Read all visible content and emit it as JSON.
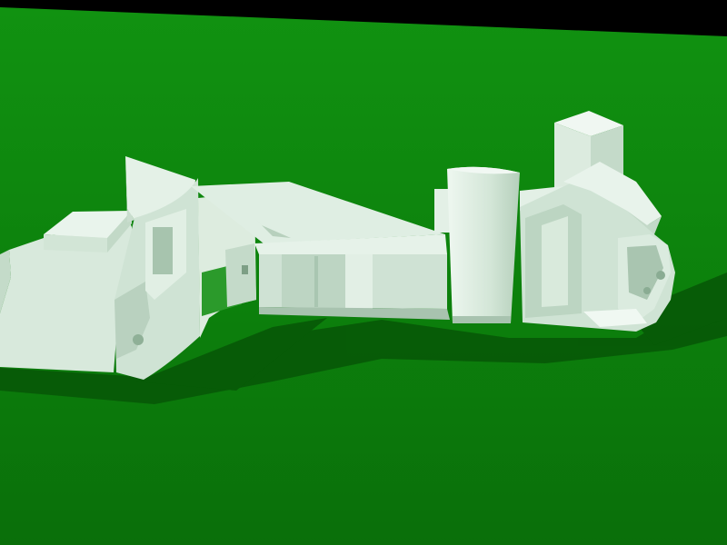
{
  "scene": {
    "type": "3d-render",
    "subject": "architectural-model",
    "colors": {
      "sky": "#000000",
      "ground_far": "#1aa01a",
      "ground_near": "#0c7a0c",
      "model_light": "#e8f2ea",
      "model_mid": "#c6dccb",
      "model_dark": "#9fbca6",
      "shadow": "#064a06"
    }
  }
}
